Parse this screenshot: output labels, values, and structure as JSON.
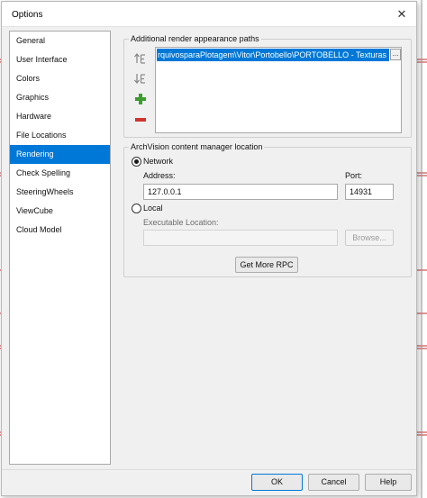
{
  "window": {
    "title": "Options",
    "close_glyph": "✕"
  },
  "sidebar": {
    "items": [
      {
        "label": "General",
        "selected": false
      },
      {
        "label": "User Interface",
        "selected": false
      },
      {
        "label": "Colors",
        "selected": false
      },
      {
        "label": "Graphics",
        "selected": false
      },
      {
        "label": "Hardware",
        "selected": false
      },
      {
        "label": "File Locations",
        "selected": false
      },
      {
        "label": "Rendering",
        "selected": true
      },
      {
        "label": "Check Spelling",
        "selected": false
      },
      {
        "label": "SteeringWheels",
        "selected": false
      },
      {
        "label": "ViewCube",
        "selected": false
      },
      {
        "label": "Cloud Model",
        "selected": false
      }
    ]
  },
  "render_paths": {
    "legend": "Additional render appearance paths",
    "paths": [
      "rquivosparaPlotagem\\Vitor\\Portobello\\PORTOBELLO - Texturas"
    ],
    "browse_glyph": "..."
  },
  "tools": {
    "move_up_icon": "move-up-icon",
    "move_down_icon": "move-down-icon",
    "add_icon": "add-icon",
    "remove_icon": "remove-icon",
    "add_color": "#2e9b2e",
    "remove_color": "#d0342c"
  },
  "archvision": {
    "legend": "ArchVision content manager location",
    "network_label": "Network",
    "network_selected": true,
    "address_label": "Address:",
    "address_value": "127.0.0.1",
    "port_label": "Port:",
    "port_value": "14931",
    "local_label": "Local",
    "local_selected": false,
    "exec_label": "Executable Location:",
    "exec_value": "",
    "browse_label": "Browse...",
    "get_more_label": "Get More RPC"
  },
  "footer": {
    "ok_label": "OK",
    "cancel_label": "Cancel",
    "help_label": "Help"
  },
  "colors": {
    "accent": "#0078d7",
    "background_lines": "#c0392b"
  }
}
